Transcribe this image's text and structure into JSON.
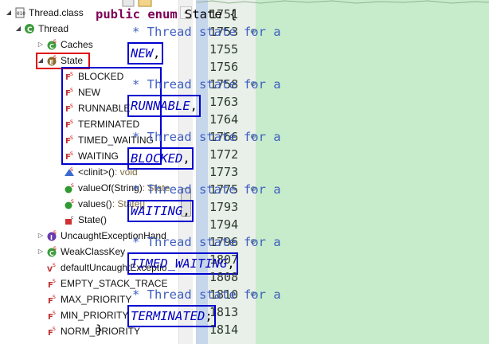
{
  "outline": {
    "root_label": "Thread.class",
    "class_label": "Thread",
    "caches_label": "Caches",
    "state_label": "State",
    "enum_constants": [
      "BLOCKED",
      "NEW",
      "RUNNABLE",
      "TERMINATED",
      "TIMED_WAITING",
      "WAITING"
    ],
    "state_members": [
      {
        "name": "<clinit>()",
        "sig": " : void"
      },
      {
        "name": "valueOf(String)",
        "sig": " : State"
      },
      {
        "name": "values()",
        "sig": " : State[]"
      },
      {
        "name": "State()",
        "sig": ""
      }
    ],
    "more_items": [
      "UncaughtExceptionHand",
      "WeakClassKey",
      "defaultUncaughtExceptio",
      "EMPTY_STACK_TRACE",
      "MAX_PRIORITY",
      "MIN_PRIORITY",
      "NORM_PRIORITY"
    ]
  },
  "editor": {
    "lines": [
      {
        "num": "1751",
        "fold": "",
        "kind": "decl",
        "kw1": "public",
        "kw2": "enum",
        "name": "State",
        "tail": " {"
      },
      {
        "num": "1753",
        "fold": "⊕",
        "kind": "comment",
        "text": "* Thread state for a"
      },
      {
        "num": "1755",
        "fold": "",
        "kind": "const",
        "name": "NEW",
        "tail": ","
      },
      {
        "num": "1756",
        "fold": "",
        "kind": "blank"
      },
      {
        "num": "1758",
        "fold": "⊕",
        "kind": "comment",
        "text": "* Thread state for a"
      },
      {
        "num": "1763",
        "fold": "",
        "kind": "const",
        "name": "RUNNABLE",
        "tail": ","
      },
      {
        "num": "1764",
        "fold": "",
        "kind": "blank"
      },
      {
        "num": "1766",
        "fold": "⊕",
        "kind": "comment",
        "text": "* Thread state for a"
      },
      {
        "num": "1772",
        "fold": "",
        "kind": "const",
        "name": "BLOCKED",
        "tail": ","
      },
      {
        "num": "1773",
        "fold": "",
        "kind": "blank"
      },
      {
        "num": "1775",
        "fold": "⊕",
        "kind": "comment",
        "text": "* Thread state for a"
      },
      {
        "num": "1793",
        "fold": "",
        "kind": "const",
        "name": "WAITING",
        "tail": ","
      },
      {
        "num": "1794",
        "fold": "",
        "kind": "blank"
      },
      {
        "num": "1796",
        "fold": "⊕",
        "kind": "comment",
        "text": "* Thread state for a"
      },
      {
        "num": "1807",
        "fold": "",
        "kind": "const",
        "name": "TIMED_WAITING",
        "tail": ","
      },
      {
        "num": "1808",
        "fold": "",
        "kind": "blank"
      },
      {
        "num": "1810",
        "fold": "⊕",
        "kind": "comment",
        "text": "* Thread state for a"
      },
      {
        "num": "1813",
        "fold": "",
        "kind": "const",
        "name": "TERMINATED",
        "tail": ";"
      },
      {
        "num": "1814",
        "fold": "",
        "kind": "close",
        "text": "}"
      }
    ]
  },
  "colors": {
    "highlight_red": "#e00000",
    "highlight_blue": "#0000d0",
    "editor_bg": "#c7eccb",
    "keyword": "#7f0055",
    "comment": "#3f5fbf",
    "field": "#0000c0"
  }
}
